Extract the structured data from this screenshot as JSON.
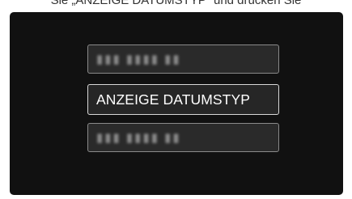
{
  "caption": "Sie „ANZEIGE DATUMSTYP“ und drücken Sie",
  "menu": {
    "items": [
      {
        "label": "",
        "state": "blurred"
      },
      {
        "label": "ANZEIGE DATUMSTYP",
        "state": "selected"
      },
      {
        "label": "",
        "state": "blurred"
      }
    ]
  },
  "colors": {
    "screen_background": "#111111",
    "item_background": "#2a2a2a",
    "item_border": "#8a8a8a",
    "selected_border": "#d8d8d8",
    "text": "#ffffff"
  }
}
